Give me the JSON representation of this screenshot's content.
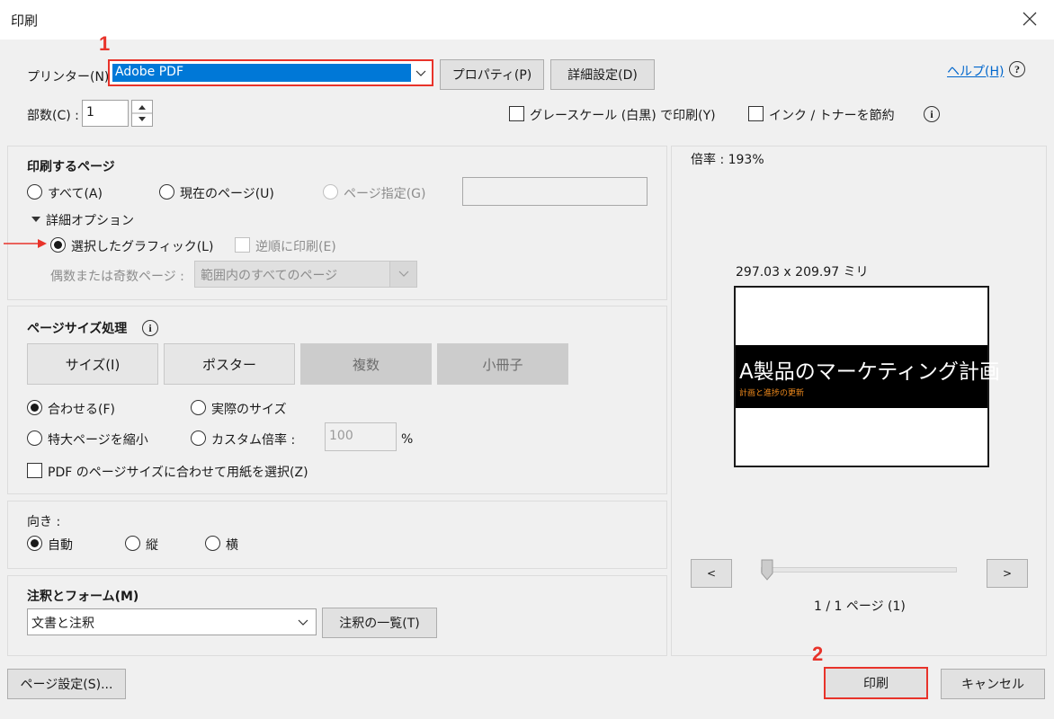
{
  "window": {
    "title": "印刷"
  },
  "annotations": {
    "step1": "1",
    "step2": "2"
  },
  "colors": {
    "accent": "#0078d7",
    "highlight_red": "#e8332a"
  },
  "printer": {
    "label": "プリンター(N) :",
    "selected": "Adobe PDF",
    "properties_button": "プロパティ(P)",
    "advanced_button": "詳細設定(D)",
    "help_link": "ヘルプ(H)"
  },
  "copies": {
    "label": "部数(C) :",
    "value": "1"
  },
  "options": {
    "grayscale": "グレースケール (白黒) で印刷(Y)",
    "save_ink": "インク / トナーを節約"
  },
  "pages_to_print": {
    "heading": "印刷するページ",
    "all": "すべて(A)",
    "current": "現在のページ(U)",
    "range": "ページ指定(G)",
    "more_options": "詳細オプション",
    "selected_graphics": "選択したグラフィック(L)",
    "reverse": "逆順に印刷(E)",
    "odd_even_label": "偶数または奇数ページ :",
    "odd_even_value": "範囲内のすべてのページ"
  },
  "page_sizing": {
    "heading": "ページサイズ処理",
    "tabs": [
      "サイズ(I)",
      "ポスター",
      "複数",
      "小冊子"
    ],
    "fit": "合わせる(F)",
    "actual": "実際のサイズ",
    "shrink": "特大ページを縮小",
    "custom": "カスタム倍率 :",
    "custom_value": "100",
    "percent": "%",
    "choose_paper": "PDF のページサイズに合わせて用紙を選択(Z)"
  },
  "orientation": {
    "heading": "向き :",
    "auto": "自動",
    "portrait": "縦",
    "landscape": "横"
  },
  "comments": {
    "heading": "注釈とフォーム(M)",
    "selected": "文書と注釈",
    "summarize_button": "注釈の一覧(T)"
  },
  "preview": {
    "scale": "倍率 : 193%",
    "dimensions": "297.03 x 209.97 ミリ",
    "slide_title": "A製品のマーケティング計画",
    "slide_subtitle": "計画と進捗の更新",
    "prev": "<",
    "next": ">",
    "page_indicator": "1 / 1 ページ (1)",
    "slider_position": 0
  },
  "footer": {
    "page_setup": "ページ設定(S)...",
    "print": "印刷",
    "cancel": "キャンセル"
  }
}
